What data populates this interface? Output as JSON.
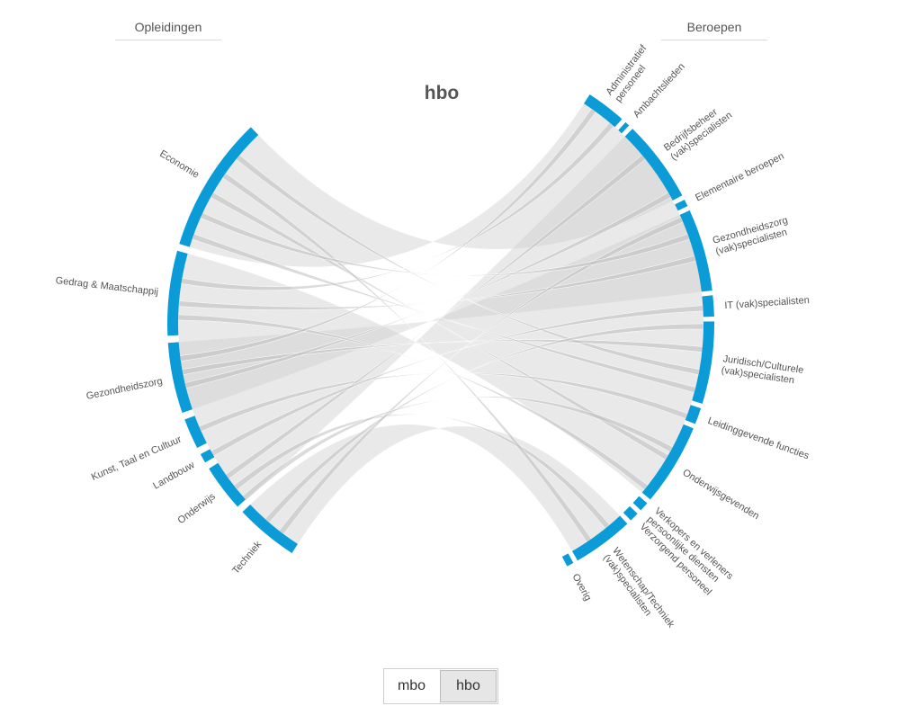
{
  "headers": {
    "left": "Opleidingen",
    "right": "Beroepen"
  },
  "title": "hbo",
  "switcher": {
    "options": [
      "mbo",
      "hbo"
    ],
    "selected": "hbo"
  },
  "colors": {
    "arc": "#0b9bd7",
    "ribbon": "#cfcfcf",
    "text": "#555555"
  },
  "opleidingen": [
    {
      "name": "Economie",
      "lines": [
        "Economie"
      ]
    },
    {
      "name": "Gedrag & Maatschappij",
      "lines": [
        "Gedrag & Maatschappij"
      ]
    },
    {
      "name": "Gezondheidszorg",
      "lines": [
        "Gezondheidszorg"
      ]
    },
    {
      "name": "Kunst, Taal en Cultuur",
      "lines": [
        "Kunst, Taal en Cultuur"
      ]
    },
    {
      "name": "Landbouw",
      "lines": [
        "Landbouw"
      ]
    },
    {
      "name": "Onderwijs",
      "lines": [
        "Onderwijs"
      ]
    },
    {
      "name": "Techniek",
      "lines": [
        "Techniek"
      ]
    }
  ],
  "beroepen": [
    {
      "name": "Administratief personeel",
      "lines": [
        "Administratief",
        "personeel"
      ]
    },
    {
      "name": "Ambachtslieden",
      "lines": [
        "Ambachtslieden"
      ]
    },
    {
      "name": "Bedrijfsbeheer (vak)specialisten",
      "lines": [
        "Bedrijfsbeheer",
        "(vak)specialisten"
      ]
    },
    {
      "name": "Elementaire beroepen",
      "lines": [
        "Elementaire beroepen"
      ]
    },
    {
      "name": "Gezondheidszorg (vak)specialisten",
      "lines": [
        "Gezondheidszorg",
        "(vak)specialisten"
      ]
    },
    {
      "name": "IT (vak)specialisten",
      "lines": [
        "IT (vak)specialisten"
      ]
    },
    {
      "name": "Juridisch/Culturele (vak)specialisten",
      "lines": [
        "Juridisch/Culturele",
        "(vak)specialisten"
      ]
    },
    {
      "name": "Leidinggevende functies",
      "lines": [
        "Leidinggevende functies"
      ]
    },
    {
      "name": "Onderwijsgevenden",
      "lines": [
        "Onderwijsgevenden"
      ]
    },
    {
      "name": "Verkopers en verleners persoonlijke diensten",
      "lines": [
        "Verkopers en verleners",
        "persoonlijke diensten"
      ]
    },
    {
      "name": "Verzorgend personeel",
      "lines": [
        "Verzorgend personeel"
      ]
    },
    {
      "name": "Wetenschap/Techniek (vak)specialisten",
      "lines": [
        "Wetenschap/Techniek",
        "(vak)specialisten"
      ]
    },
    {
      "name": "Overig",
      "lines": [
        "Overig"
      ]
    }
  ]
}
